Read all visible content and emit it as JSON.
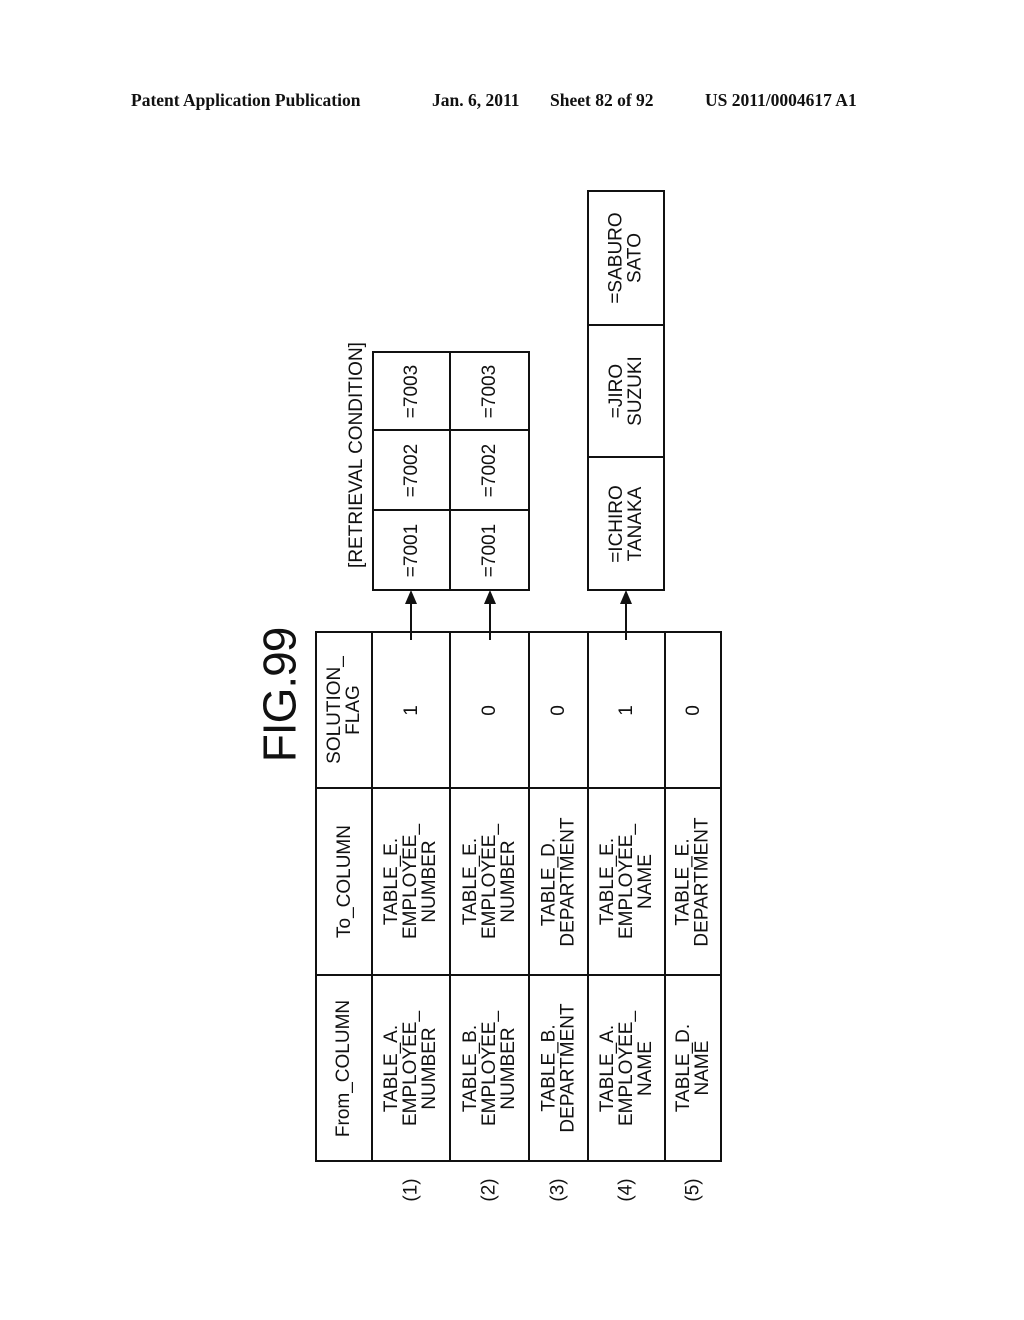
{
  "header": {
    "publication": "Patent Application Publication",
    "date": "Jan. 6, 2011",
    "sheet": "Sheet 82 of 92",
    "number": "US 2011/0004617 A1"
  },
  "figure": {
    "title": "FIG.99"
  },
  "table": {
    "columns": {
      "from": "From_COLUMN",
      "to": "To_COLUMN",
      "flag": "SOLUTION_\nFLAG"
    },
    "rows": [
      {
        "num": "(1)",
        "from": "TABLE_A.\nEMPLOYEE_\nNUMBER",
        "to": "TABLE_E.\nEMPLOYEE_\nNUMBER",
        "flag": "1"
      },
      {
        "num": "(2)",
        "from": "TABLE_B.\nEMPLOYEE_\nNUMBER",
        "to": "TABLE_E.\nEMPLOYEE_\nNUMBER",
        "flag": "0"
      },
      {
        "num": "(3)",
        "from": "TABLE_B.\nDEPARTMENT",
        "to": "TABLE_D.\nDEPARTMENT",
        "flag": "0"
      },
      {
        "num": "(4)",
        "from": "TABLE_A.\nEMPLOYEE_\nNAME",
        "to": "TABLE_E.\nEMPLOYEE_\nNAME",
        "flag": "1"
      },
      {
        "num": "(5)",
        "from": "TABLE_D.\nNAME",
        "to": "TABLE_E.\nDEPARTMENT",
        "flag": "0"
      }
    ]
  },
  "retrieval_condition": {
    "label": "[RETRIEVAL CONDITION]",
    "row1": [
      "=7001",
      "=7002",
      "=7003"
    ],
    "row2": [
      "=7001",
      "=7002",
      "=7003"
    ]
  },
  "names": [
    "=ICHIRO\nTANAKA",
    "=JIRO\nSUZUKI",
    "=SABURO\nSATO"
  ]
}
